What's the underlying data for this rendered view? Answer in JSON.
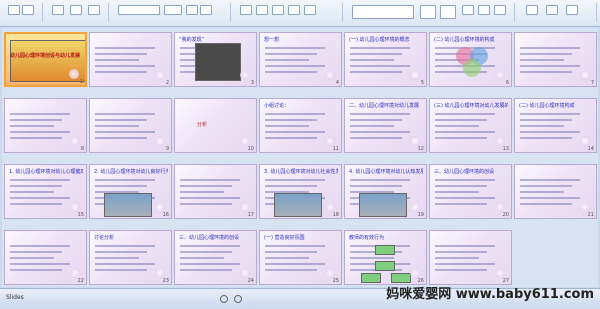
{
  "ribbon": {
    "groups": [
      "clipboard",
      "slides",
      "font",
      "paragraph",
      "drawing",
      "editing"
    ]
  },
  "status": {
    "left_text": "Slides",
    "watermark": "妈咪爱婴网 www.baby611.com"
  },
  "slides": [
    {
      "num": "1",
      "title": "幼儿园心理环境创设与幼儿发展",
      "style": "cover"
    },
    {
      "num": "2",
      "title": "",
      "style": "text"
    },
    {
      "num": "3",
      "title": "“我的发现”",
      "style": "photo-dark"
    },
    {
      "num": "4",
      "title": "想一想",
      "style": "text"
    },
    {
      "num": "5",
      "title": "(一) 幼儿园心理环境的概念",
      "style": "text"
    },
    {
      "num": "6",
      "title": "(二) 幼儿园心理环境的构成",
      "style": "venn"
    },
    {
      "num": "7",
      "title": "",
      "style": "text"
    },
    {
      "num": "8",
      "title": "",
      "style": "text"
    },
    {
      "num": "9",
      "title": "",
      "style": "text"
    },
    {
      "num": "10",
      "title": "分析",
      "style": "red"
    },
    {
      "num": "11",
      "title": "小组讨论：",
      "style": "text"
    },
    {
      "num": "12",
      "title": "二、幼儿园心理环境对幼儿发展",
      "style": "text"
    },
    {
      "num": "13",
      "title": "(三) 幼儿园心理环境对幼儿发展的作用",
      "style": "text"
    },
    {
      "num": "14",
      "title": "(二) 幼儿园心理环境构成",
      "style": "text"
    },
    {
      "num": "15",
      "title": "1. 幼儿园心理环境对幼儿心理健康的影响",
      "style": "text"
    },
    {
      "num": "16",
      "title": "2. 幼儿园心理环境对幼儿良好行为的影响",
      "style": "photo"
    },
    {
      "num": "17",
      "title": "",
      "style": "text"
    },
    {
      "num": "18",
      "title": "3. 幼儿园心理环境对幼儿社会性发展的影响",
      "style": "photo"
    },
    {
      "num": "19",
      "title": "4. 幼儿园心理环境对幼儿认知发展的影响",
      "style": "photo"
    },
    {
      "num": "20",
      "title": "三、幼儿园心理环境的创设",
      "style": "text"
    },
    {
      "num": "21",
      "title": "",
      "style": "text"
    },
    {
      "num": "22",
      "title": "",
      "style": "text"
    },
    {
      "num": "23",
      "title": "讨论分析",
      "style": "text"
    },
    {
      "num": "24",
      "title": "三、幼儿园心理环境的创设",
      "style": "text"
    },
    {
      "num": "25",
      "title": "(一) 营造良好氛围",
      "style": "text"
    },
    {
      "num": "26",
      "title": "教师的有效行为",
      "style": "diagram"
    },
    {
      "num": "27",
      "title": "",
      "style": "text"
    }
  ]
}
